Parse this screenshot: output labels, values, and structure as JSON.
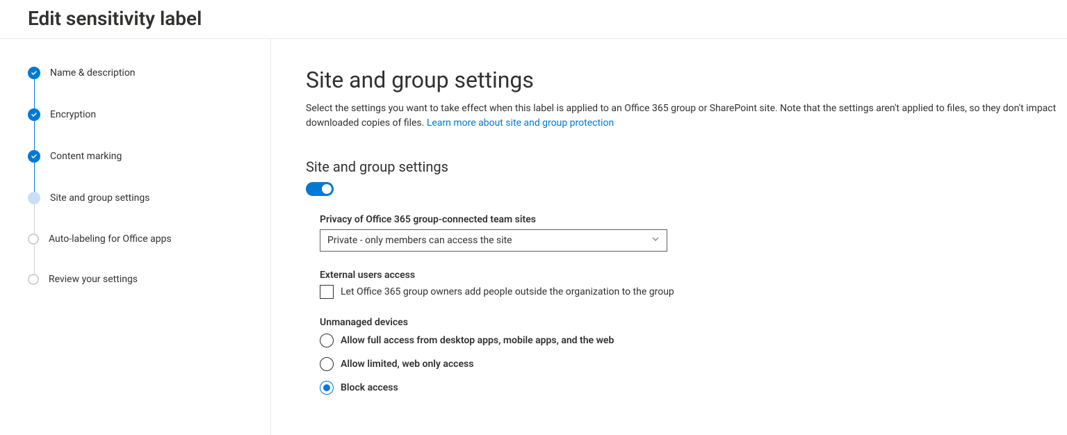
{
  "page_title": "Edit sensitivity label",
  "steps": [
    {
      "label": "Name & description",
      "state": "completed"
    },
    {
      "label": "Encryption",
      "state": "completed"
    },
    {
      "label": "Content marking",
      "state": "completed"
    },
    {
      "label": "Site and group settings",
      "state": "current"
    },
    {
      "label": "Auto-labeling for Office apps",
      "state": "pending"
    },
    {
      "label": "Review your settings",
      "state": "pending"
    }
  ],
  "main": {
    "heading": "Site and group settings",
    "description_pre": "Select the settings you want to take effect when this label is applied to an Office 365 group or SharePoint site. Note that the settings aren't applied to files, so they don't impact downloaded copies of files. ",
    "description_link": "Learn more about site and group protection",
    "section_heading": "Site and group settings",
    "toggle_on": true,
    "privacy": {
      "label": "Privacy of Office 365 group-connected team sites",
      "selected": "Private - only members can access the site"
    },
    "external": {
      "label": "External users access",
      "checkbox_label": "Let Office 365 group owners add people outside the organization to the group",
      "checked": false
    },
    "unmanaged": {
      "label": "Unmanaged devices",
      "options": [
        "Allow full access from desktop apps, mobile apps, and the web",
        "Allow limited, web only access",
        "Block access"
      ],
      "selected_index": 2
    }
  }
}
